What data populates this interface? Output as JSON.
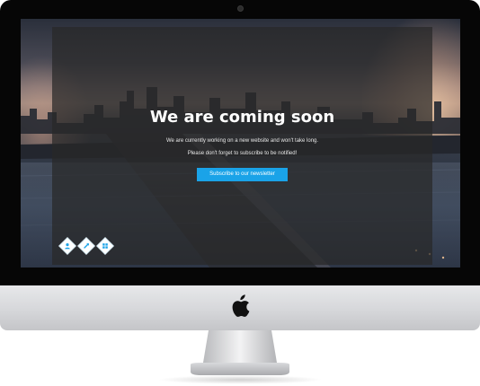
{
  "hero": {
    "headline": "We are coming soon",
    "line1": "We are currently working on a new website and won't take long.",
    "line2": "Please don't forget to subscribe to be notified!",
    "cta_label": "Subscribe to our newsletter"
  },
  "social_icons": [
    "user-icon",
    "link-icon",
    "grid-icon"
  ],
  "colors": {
    "accent": "#1aa3e8",
    "bezel": "#060606",
    "chin": "#d6d7da",
    "overlay": "#282828"
  }
}
